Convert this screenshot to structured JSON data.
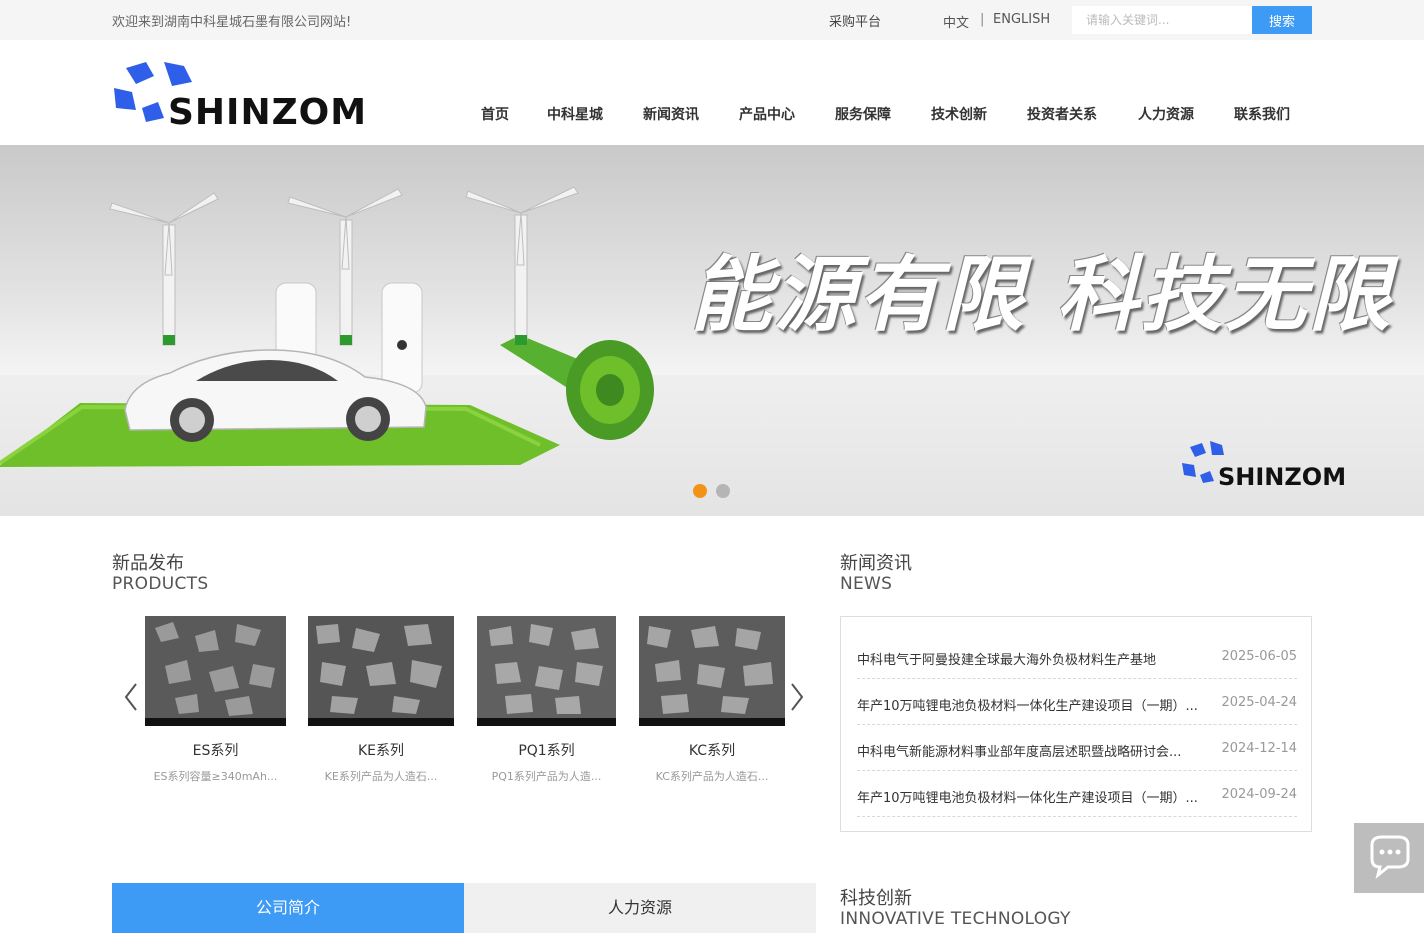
{
  "topbar": {
    "welcome": "欢迎来到湖南中科星城石墨有限公司网站!",
    "procurement": "采购平台",
    "lang_cn": "中文",
    "lang_sep": "|",
    "lang_en": "ENGLISH",
    "search_placeholder": "请输入关键词...",
    "search_button": "搜索"
  },
  "logo": {
    "text": "SHINZOM"
  },
  "nav": [
    "首页",
    "中科星城",
    "新闻资讯",
    "产品中心",
    "服务保障",
    "技术创新",
    "投资者关系",
    "人力资源",
    "联系我们"
  ],
  "banner": {
    "slogan": "能源有限  科技无限",
    "brand": "SHINZOM",
    "slides": 2,
    "active_slide": 1
  },
  "products": {
    "title_cn": "新品发布",
    "title_en": "PRODUCTS",
    "items": [
      {
        "name": "ES系列",
        "desc": "ES系列容量≥340mAh..."
      },
      {
        "name": "KE系列",
        "desc": "KE系列产品为人造石..."
      },
      {
        "name": "PQ1系列",
        "desc": "PQ1系列产品为人造..."
      },
      {
        "name": "KC系列",
        "desc": "KC系列产品为人造石..."
      }
    ]
  },
  "news": {
    "title_cn": "新闻资讯",
    "title_en": "NEWS",
    "items": [
      {
        "title": "中科电气于阿曼投建全球最大海外负极材料生产基地",
        "date": "2025-06-05"
      },
      {
        "title": "年产10万吨锂电池负极材料一体化生产建设项目（一期）...",
        "date": "2025-04-24"
      },
      {
        "title": "中科电气新能源材料事业部年度高层述职暨战略研讨会...",
        "date": "2024-12-14"
      },
      {
        "title": "年产10万吨锂电池负极材料一体化生产建设项目（一期）...",
        "date": "2024-09-24"
      }
    ]
  },
  "tabs": [
    "公司简介",
    "人力资源"
  ],
  "tech": {
    "title_cn": "科技创新",
    "title_en": "INNOVATIVE TECHNOLOGY"
  },
  "colors": {
    "accent": "#3d9af5",
    "dot_active": "#f39219",
    "brand_blue": "#2f5fe8",
    "grass": "#6fbf2a"
  }
}
